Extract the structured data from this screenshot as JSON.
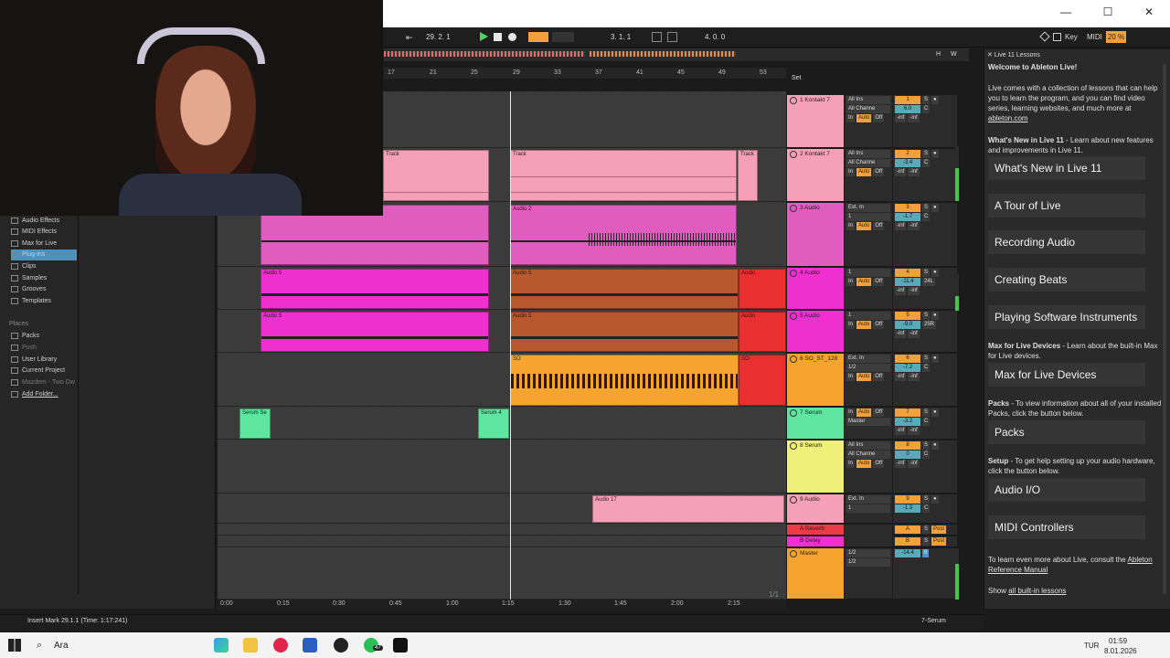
{
  "window": {
    "minimize": "—",
    "maximize": "☐",
    "close": "✕"
  },
  "transport": {
    "tempo_position": "29.  2.  1",
    "arr_position": "3.  1.  1",
    "loop_length": "4.  0.  0",
    "key_label": "Key",
    "midi_label": "MIDI",
    "cpu": "20 %"
  },
  "ruler": {
    "bars": [
      "17",
      "21",
      "25",
      "29",
      "33",
      "37",
      "41",
      "45",
      "49",
      "53"
    ],
    "set_label": "Set"
  },
  "browser": {
    "categories": [
      "Audio Effects",
      "MIDI Effects",
      "Max for Live",
      "Plug-ins",
      "Clips",
      "Samples",
      "Grooves",
      "Templates"
    ],
    "places_label": "Places",
    "places": [
      "Packs",
      "Push",
      "User Library",
      "Current Project",
      "Mazdem - Two Dw",
      "Add Folder..."
    ]
  },
  "tracks": [
    {
      "name": "1 Kontakt 7",
      "color": "#f5a0b8",
      "input": "All Ins",
      "channel": "All Channe",
      "num": "1",
      "vol": "6.0",
      "pan": "C",
      "send_a": "-inf",
      "send_b": "-inf"
    },
    {
      "name": "2 Kontakt 7",
      "color": "#f5a0b8",
      "input": "All Ins",
      "channel": "All Channe",
      "num": "2",
      "vol": "-3.4",
      "pan": "C",
      "send_a": "-inf",
      "send_b": "-inf"
    },
    {
      "name": "3 Audio",
      "color": "#e05cbe",
      "input": "Ext. In",
      "channel": "1",
      "num": "3",
      "vol": "-1.7",
      "pan": "C",
      "send_a": "-inf",
      "send_b": "-inf"
    },
    {
      "name": "4 Audio",
      "color": "#f02fd0",
      "input": "1",
      "channel": "",
      "num": "4",
      "vol": "-11.4",
      "pan": "24L",
      "send_a": "-inf",
      "send_b": "-inf"
    },
    {
      "name": "5 Audio",
      "color": "#f02fd0",
      "input": "1",
      "channel": "",
      "num": "5",
      "vol": "-9.0",
      "pan": "25R",
      "send_a": "-inf",
      "send_b": "-inf"
    },
    {
      "name": "6 SO_ST_128",
      "color": "#f5a52f",
      "input": "Ext. In",
      "channel": "1/2",
      "num": "6",
      "vol": "-7.2",
      "pan": "C",
      "send_a": "-inf",
      "send_b": "-inf"
    },
    {
      "name": "7 Serum",
      "color": "#5ee6a0",
      "input": "",
      "channel": "",
      "num": "7",
      "vol": "-3.2",
      "pan": "C",
      "send_a": "-inf",
      "send_b": "-inf"
    },
    {
      "name": "8 Serum",
      "color": "#eef07a",
      "input": "All Ins",
      "channel": "All Channe",
      "num": "8",
      "vol": "0",
      "pan": "C",
      "send_a": "-inf",
      "send_b": "-inf"
    },
    {
      "name": "9 Audio",
      "color": "#f5a0b8",
      "input": "Ext. In",
      "channel": "1",
      "num": "9",
      "vol": "-1.3",
      "pan": "C",
      "send_a": "-inf",
      "send_b": "-inf"
    }
  ],
  "returns": [
    {
      "name": "A Reverb",
      "color": "#ec3b46",
      "label": "A"
    },
    {
      "name": "B Delay",
      "color": "#f02fd0",
      "label": "B"
    }
  ],
  "master": {
    "name": "Master",
    "color": "#f5a52f",
    "in1": "1/2",
    "in2": "1/2",
    "vol": "-14.4",
    "pan": "0"
  },
  "clips": {
    "track": "Track",
    "audio2": "Audio 2",
    "audio5": "Audio 5",
    "audio": "Audio",
    "so": "SO",
    "serum_se": "Serum Se",
    "serum4": "Serum 4",
    "audio17": "Audio 17"
  },
  "time_axis": [
    "0:00",
    "0:15",
    "0:30",
    "0:45",
    "1:00",
    "1:15",
    "1:30",
    "1:45",
    "2:00",
    "2:15"
  ],
  "page_indicator": "1/1",
  "lessons": {
    "title": "Live 11 Lessons",
    "welcome": "Welcome to Ableton Live!",
    "intro": "Live comes with a collection of lessons that can help you to learn the program, and you can find video series, learning websites, and much more at",
    "intro_link": "ableton.com",
    "whats_new_text_bold": "What's New in Live 11",
    "whats_new_text": " - Learn about new features and improvements in Live 11.",
    "buttons": [
      "What's New in Live 11",
      "A Tour of Live",
      "Recording Audio",
      "Creating Beats",
      "Playing Software Instruments"
    ],
    "m4l_bold": "Max for Live Devices",
    "m4l_text": " - Learn about the built-in Max for Live devices.",
    "m4l_button": "Max for Live Devices",
    "packs_bold": "Packs",
    "packs_text": " - To view information about all of your installed Packs, click the button below.",
    "packs_button": "Packs",
    "setup_bold": "Setup",
    "setup_text": " - To get help setting up your audio hardware, click the button below.",
    "audio_io_button": "Audio I/O",
    "midi_button": "MIDI Controllers",
    "footer_text": "To learn even more about Live, consult the",
    "footer_link": "Ableton Reference Manual",
    "show_text": "Show",
    "show_link": "all built-in lessons"
  },
  "status": {
    "message": "Insert Mark 29.1.1 (Time: 1:17:241)",
    "track_selector": "7-Serum"
  },
  "taskbar": {
    "search": "Ara",
    "lang": "TUR",
    "time": "01:59",
    "date": "8.01.2026",
    "badge": "47"
  }
}
